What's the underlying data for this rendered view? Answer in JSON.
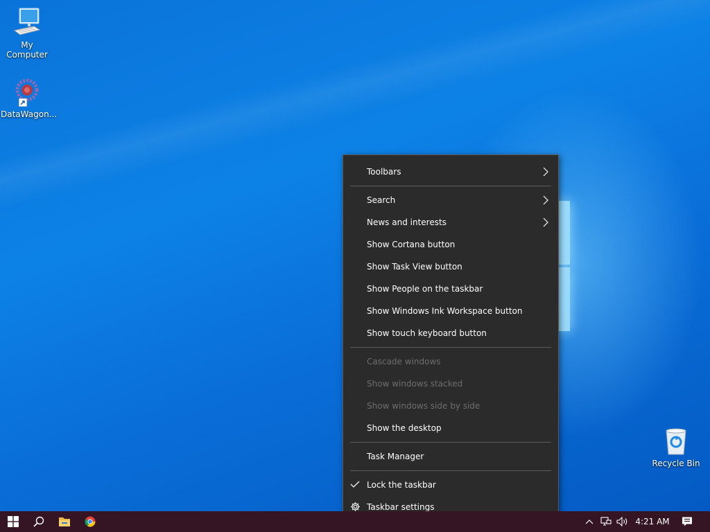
{
  "desktop": {
    "icons": [
      {
        "label": "My Computer",
        "icon": "computer-icon"
      },
      {
        "label": "DataWagon...",
        "icon": "datawagon-app-icon"
      },
      {
        "label": "Recycle Bin",
        "icon": "recycle-bin-icon"
      }
    ]
  },
  "context_menu": {
    "groups": [
      [
        {
          "label": "Toolbars",
          "submenu": true,
          "enabled": true
        }
      ],
      [
        {
          "label": "Search",
          "submenu": true,
          "enabled": true
        },
        {
          "label": "News and interests",
          "submenu": true,
          "enabled": true
        },
        {
          "label": "Show Cortana button",
          "enabled": true
        },
        {
          "label": "Show Task View button",
          "enabled": true
        },
        {
          "label": "Show People on the taskbar",
          "enabled": true
        },
        {
          "label": "Show Windows Ink Workspace button",
          "enabled": true
        },
        {
          "label": "Show touch keyboard button",
          "enabled": true
        }
      ],
      [
        {
          "label": "Cascade windows",
          "enabled": false
        },
        {
          "label": "Show windows stacked",
          "enabled": false
        },
        {
          "label": "Show windows side by side",
          "enabled": false
        },
        {
          "label": "Show the desktop",
          "enabled": true
        }
      ],
      [
        {
          "label": "Task Manager",
          "enabled": true
        }
      ],
      [
        {
          "label": "Lock the taskbar",
          "enabled": true,
          "checked": true
        },
        {
          "label": "Taskbar settings",
          "enabled": true,
          "icon": "gear-icon"
        }
      ]
    ]
  },
  "taskbar": {
    "pinned": [
      "start-windows-icon",
      "search-icon",
      "file-explorer-icon",
      "chrome-icon"
    ],
    "tray": [
      "chevron-up-icon",
      "network-icon",
      "volume-icon"
    ],
    "clock": "4:21 AM",
    "notification_icon": "action-center-icon"
  },
  "colors": {
    "taskbar": "#351524",
    "menu_bg": "#2b2b2b",
    "desktop_blue": "#0a73d9"
  }
}
